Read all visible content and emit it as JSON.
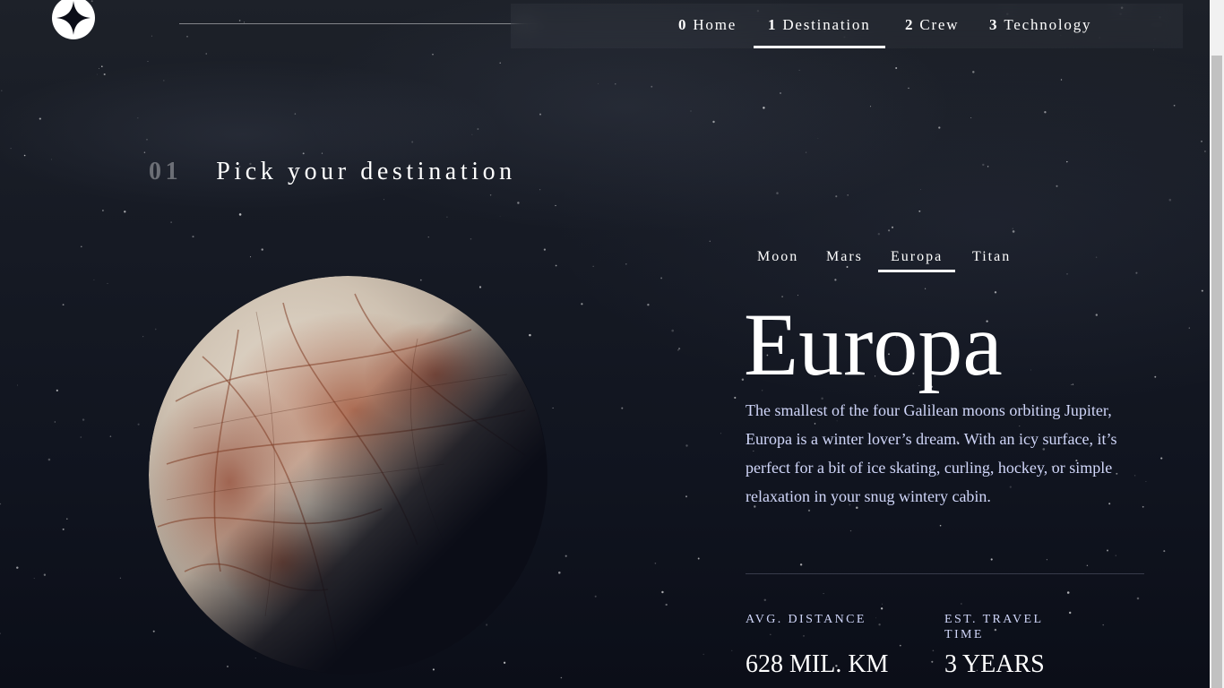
{
  "nav": {
    "items": [
      {
        "num": "0",
        "label": "Home"
      },
      {
        "num": "1",
        "label": "Destination"
      },
      {
        "num": "2",
        "label": "Crew"
      },
      {
        "num": "3",
        "label": "Technology"
      }
    ]
  },
  "main": {
    "heading_num": "01",
    "heading_text": "Pick your destination",
    "tabs": [
      "Moon",
      "Mars",
      "Europa",
      "Titan"
    ],
    "planet_name": "Europa",
    "description": "The smallest of the four Galilean moons orbiting Jupiter, Europa is a winter lover’s dream. With an icy surface, it’s perfect for a bit of ice skating, curling, hockey, or simple relaxation in your snug wintery cabin.",
    "stats": {
      "distance_label": "AVG. DISTANCE",
      "distance_value": "628 MIL. KM",
      "travel_label": "EST. TRAVEL TIME",
      "travel_value": "3 YEARS"
    }
  },
  "icons": {
    "logo": "star-logo-icon"
  },
  "colors": {
    "background": "#0b0d17",
    "text": "#ffffff",
    "muted": "#d0d6f9"
  }
}
